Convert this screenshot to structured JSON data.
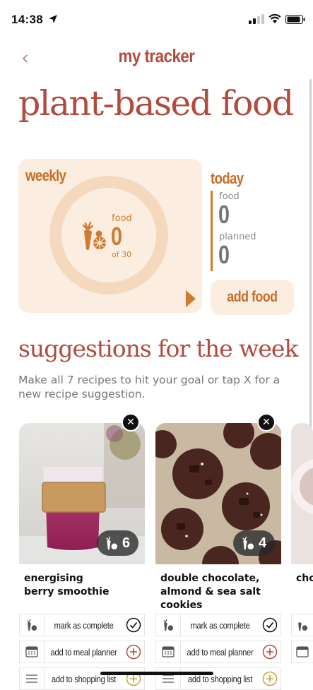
{
  "status_bar": {
    "time": "14:38"
  },
  "nav": {
    "back": "‹",
    "title": "my tracker"
  },
  "page": {
    "title": "plant-based food"
  },
  "weekly": {
    "label": "weekly",
    "ring_label": "food",
    "value": "0",
    "sub": "of 30",
    "progress": 0
  },
  "today": {
    "label": "today",
    "food_label": "food",
    "food_value": "0",
    "planned_label": "planned",
    "planned_value": "0",
    "add_button": "add food"
  },
  "suggestions": {
    "title": "suggestions for the week",
    "description": "Make all 7 recipes to hit your goal or tap X for a new recipe suggestion.",
    "cards": [
      {
        "title_line1": "energising",
        "title_line2": "berry smoothie",
        "title_line3": "",
        "count": "6",
        "actions": [
          "mark as complete",
          "add to meal planner",
          "add to shopping list"
        ]
      },
      {
        "title_line1": "double chocolate,",
        "title_line2": "almond & sea salt",
        "title_line3": "cookies",
        "count": "4",
        "actions": [
          "mark as complete",
          "add to meal planner",
          "add to shopping list"
        ]
      },
      {
        "title_line1": "cho"
      }
    ]
  },
  "colors": {
    "accent": "#b04b3e",
    "orange": "#d07a2f",
    "peach": "#fbeee1",
    "ring": "#f5d9bf"
  },
  "icons": [
    "back-chevron-icon",
    "location-arrow-icon",
    "signal-icon",
    "wifi-icon",
    "battery-icon",
    "carrot-orange-icon",
    "play-arrow-icon",
    "close-icon",
    "check-circle-icon",
    "plus-circle-icon",
    "calendar-icon",
    "list-icon"
  ]
}
